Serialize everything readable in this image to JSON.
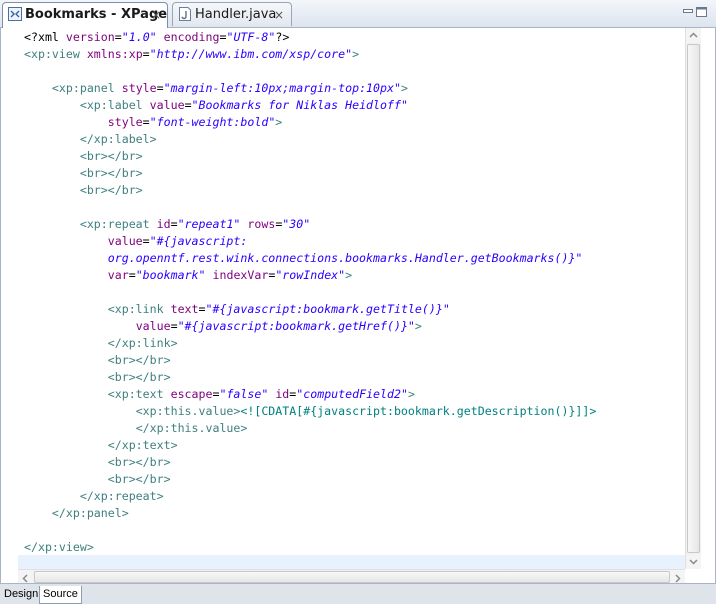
{
  "tabs": [
    {
      "label": "Bookmarks - XPage",
      "icon": "xpage-file-icon",
      "active": true
    },
    {
      "label": "Handler.java",
      "icon": "java-file-icon",
      "active": false
    }
  ],
  "close_glyph": "×",
  "code_lines": [
    [
      [
        "p",
        "<?xml "
      ],
      [
        "a",
        "version"
      ],
      [
        "c",
        "="
      ],
      [
        "v",
        "\"1.0\""
      ],
      [
        "c",
        " "
      ],
      [
        "a",
        "encoding"
      ],
      [
        "c",
        "="
      ],
      [
        "v",
        "\"UTF-8\""
      ],
      [
        "p",
        "?>"
      ]
    ],
    [
      [
        "t",
        "<xp:view "
      ],
      [
        "a",
        "xmlns:xp"
      ],
      [
        "c",
        "="
      ],
      [
        "v",
        "\"http://www.ibm.com/xsp/core\""
      ],
      [
        "t",
        ">"
      ]
    ],
    [],
    [
      [
        "c",
        "    "
      ],
      [
        "t",
        "<xp:panel "
      ],
      [
        "a",
        "style"
      ],
      [
        "c",
        "="
      ],
      [
        "v",
        "\"margin-left:10px;margin-top:10px\""
      ],
      [
        "t",
        ">"
      ]
    ],
    [
      [
        "c",
        "        "
      ],
      [
        "t",
        "<xp:label "
      ],
      [
        "a",
        "value"
      ],
      [
        "c",
        "="
      ],
      [
        "v",
        "\"Bookmarks for Niklas Heidloff\""
      ]
    ],
    [
      [
        "c",
        "            "
      ],
      [
        "a",
        "style"
      ],
      [
        "c",
        "="
      ],
      [
        "v",
        "\"font-weight:bold\""
      ],
      [
        "t",
        ">"
      ]
    ],
    [
      [
        "c",
        "        "
      ],
      [
        "t",
        "</xp:label>"
      ]
    ],
    [
      [
        "c",
        "        "
      ],
      [
        "t",
        "<br></br>"
      ]
    ],
    [
      [
        "c",
        "        "
      ],
      [
        "t",
        "<br></br>"
      ]
    ],
    [
      [
        "c",
        "        "
      ],
      [
        "t",
        "<br></br>"
      ]
    ],
    [],
    [
      [
        "c",
        "        "
      ],
      [
        "t",
        "<xp:repeat "
      ],
      [
        "a",
        "id"
      ],
      [
        "c",
        "="
      ],
      [
        "v",
        "\"repeat1\""
      ],
      [
        "c",
        " "
      ],
      [
        "a",
        "rows"
      ],
      [
        "c",
        "="
      ],
      [
        "v",
        "\"30\""
      ]
    ],
    [
      [
        "c",
        "            "
      ],
      [
        "a",
        "value"
      ],
      [
        "c",
        "="
      ],
      [
        "v",
        "\"#{javascript:"
      ]
    ],
    [
      [
        "c",
        "            "
      ],
      [
        "v",
        "org.openntf.rest.wink.connections.bookmarks.Handler.getBookmarks()}\""
      ]
    ],
    [
      [
        "c",
        "            "
      ],
      [
        "a",
        "var"
      ],
      [
        "c",
        "="
      ],
      [
        "v",
        "\"bookmark\""
      ],
      [
        "c",
        " "
      ],
      [
        "a",
        "indexVar"
      ],
      [
        "c",
        "="
      ],
      [
        "v",
        "\"rowIndex\""
      ],
      [
        "t",
        ">"
      ]
    ],
    [],
    [
      [
        "c",
        "            "
      ],
      [
        "t",
        "<xp:link "
      ],
      [
        "a",
        "text"
      ],
      [
        "c",
        "="
      ],
      [
        "v",
        "\"#{javascript:bookmark.getTitle()}\""
      ]
    ],
    [
      [
        "c",
        "                "
      ],
      [
        "a",
        "value"
      ],
      [
        "c",
        "="
      ],
      [
        "v",
        "\"#{javascript:bookmark.getHref()}\""
      ],
      [
        "t",
        ">"
      ]
    ],
    [
      [
        "c",
        "            "
      ],
      [
        "t",
        "</xp:link>"
      ]
    ],
    [
      [
        "c",
        "            "
      ],
      [
        "t",
        "<br></br>"
      ]
    ],
    [
      [
        "c",
        "            "
      ],
      [
        "t",
        "<br></br>"
      ]
    ],
    [
      [
        "c",
        "            "
      ],
      [
        "t",
        "<xp:text "
      ],
      [
        "a",
        "escape"
      ],
      [
        "c",
        "="
      ],
      [
        "v",
        "\"false\""
      ],
      [
        "c",
        " "
      ],
      [
        "a",
        "id"
      ],
      [
        "c",
        "="
      ],
      [
        "v",
        "\"computedField2\""
      ],
      [
        "t",
        ">"
      ]
    ],
    [
      [
        "c",
        "                "
      ],
      [
        "t",
        "<xp:this.value>"
      ],
      [
        "d",
        "<![CDATA[#{javascript:bookmark.getDescription()}]]>"
      ]
    ],
    [
      [
        "c",
        "                "
      ],
      [
        "t",
        "</xp:this.value>"
      ]
    ],
    [
      [
        "c",
        "            "
      ],
      [
        "t",
        "</xp:text>"
      ]
    ],
    [
      [
        "c",
        "            "
      ],
      [
        "t",
        "<br></br>"
      ]
    ],
    [
      [
        "c",
        "            "
      ],
      [
        "t",
        "<br></br>"
      ]
    ],
    [
      [
        "c",
        "        "
      ],
      [
        "t",
        "</xp:repeat>"
      ]
    ],
    [
      [
        "c",
        "    "
      ],
      [
        "t",
        "</xp:panel>"
      ]
    ],
    [],
    [
      [
        "t",
        "</xp:view>"
      ]
    ]
  ],
  "bottom_tabs": [
    {
      "label": "Design",
      "active": false
    },
    {
      "label": "Source",
      "active": true
    }
  ],
  "colors": {
    "tag": "#3f7f7f",
    "attribute": "#7f007f",
    "value": "#2a00ff",
    "cdata": "#008080",
    "current_line": "#e8f2fe"
  }
}
